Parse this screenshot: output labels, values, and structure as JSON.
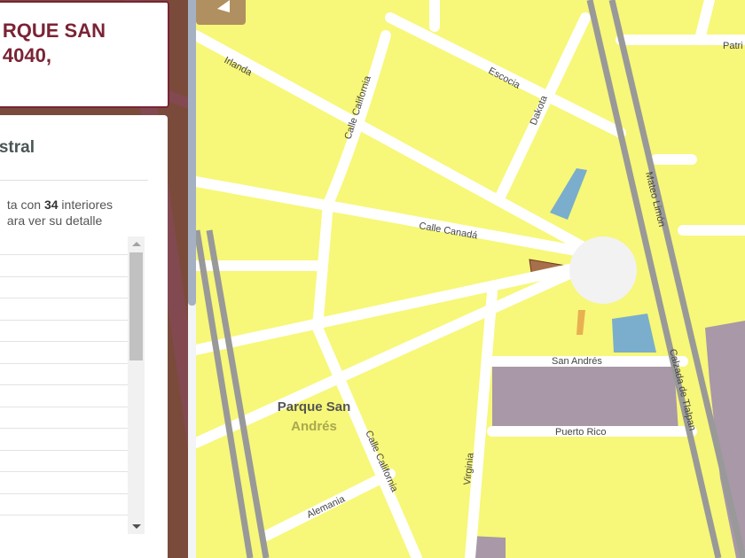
{
  "title_card": {
    "line1": "RQUE SAN",
    "line2": "4040,"
  },
  "info_card": {
    "heading": "stral",
    "desc_pre": "ta con ",
    "desc_count": "34",
    "desc_post": " interiores",
    "desc_line2": "ara ver su detalle"
  },
  "list": {
    "rows": 13
  },
  "map": {
    "park_label_1": "Parque San",
    "park_label_2": "Andrés",
    "streets": {
      "irlanda": "Irlanda",
      "california_n": "Calle California",
      "escocia": "Escocia",
      "dakota": "Dakota",
      "canada": "Calle Canadá",
      "mateo": "Mateo Limón",
      "patr": "Patri",
      "san_andres": "San Andrés",
      "puerto_rico": "Puerto Rico",
      "tlalpan": "Calzada de Tlalpan",
      "california_s": "Calle California",
      "virginia": "Virginia",
      "alemania": "Alemania"
    }
  },
  "colors": {
    "accent": "#7a2335",
    "block": "#f7f779",
    "lot": "#a898a8",
    "water": "#7aaecc",
    "parcel": "#a8704a"
  }
}
